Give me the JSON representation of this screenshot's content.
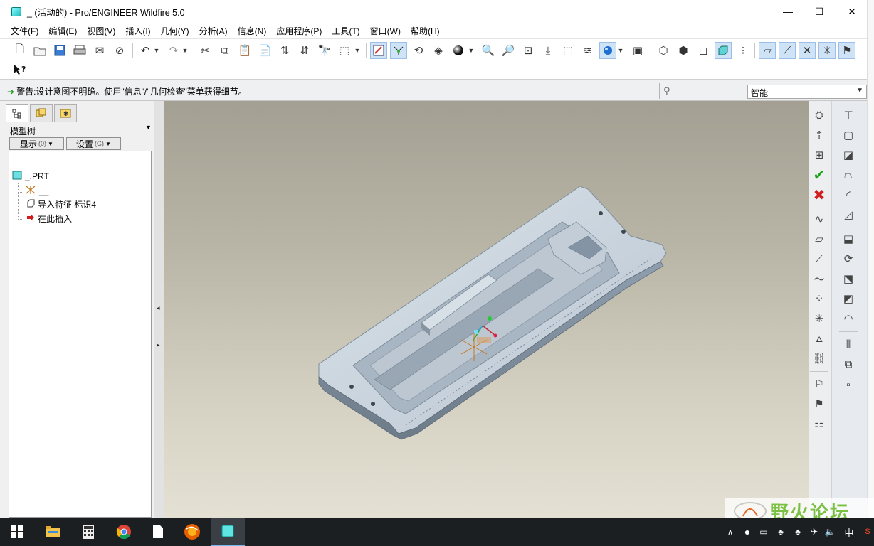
{
  "window": {
    "title": "_ (活动的) - Pro/ENGINEER Wildfire 5.0",
    "minimize_glyph": "—",
    "maximize_glyph": "☐",
    "close_glyph": "✕"
  },
  "menu": [
    "文件(F)",
    "编辑(E)",
    "视图(V)",
    "插入(I)",
    "几何(Y)",
    "分析(A)",
    "信息(N)",
    "应用程序(P)",
    "工具(T)",
    "窗口(W)",
    "帮助(H)"
  ],
  "message": {
    "text": "警告:设计意图不明确。使用\"信息\"/\"几何检查\"菜单获得细节。"
  },
  "filter": {
    "value": "智能"
  },
  "model_tree": {
    "title": "模型树",
    "show_button": "显示",
    "show_key": "(0)",
    "settings_button": "设置",
    "settings_key": "(G)",
    "nodes": [
      {
        "label": "_.PRT",
        "icon": "part-icon"
      },
      {
        "label": "__",
        "icon": "csys-icon"
      },
      {
        "label": "导入特征 标识4",
        "icon": "import-feature-icon"
      },
      {
        "label": "在此插入",
        "icon": "insert-here-arrow-icon"
      }
    ]
  },
  "watermark": {
    "text": "野火论坛"
  },
  "taskbar": {
    "ime": "中",
    "icons": [
      "start-icon",
      "file-explorer-icon",
      "calculator-icon",
      "chrome-icon",
      "document-icon",
      "firefox-icon",
      "proe-icon"
    ]
  },
  "colors": {
    "part_fill": "#c6d0da",
    "viewport_top": "#a3a093",
    "viewport_bottom": "#e4e1d4",
    "warning_arrow": "#1b9a1b",
    "accept": "#1aa31a",
    "cancel": "#d11f1f"
  }
}
